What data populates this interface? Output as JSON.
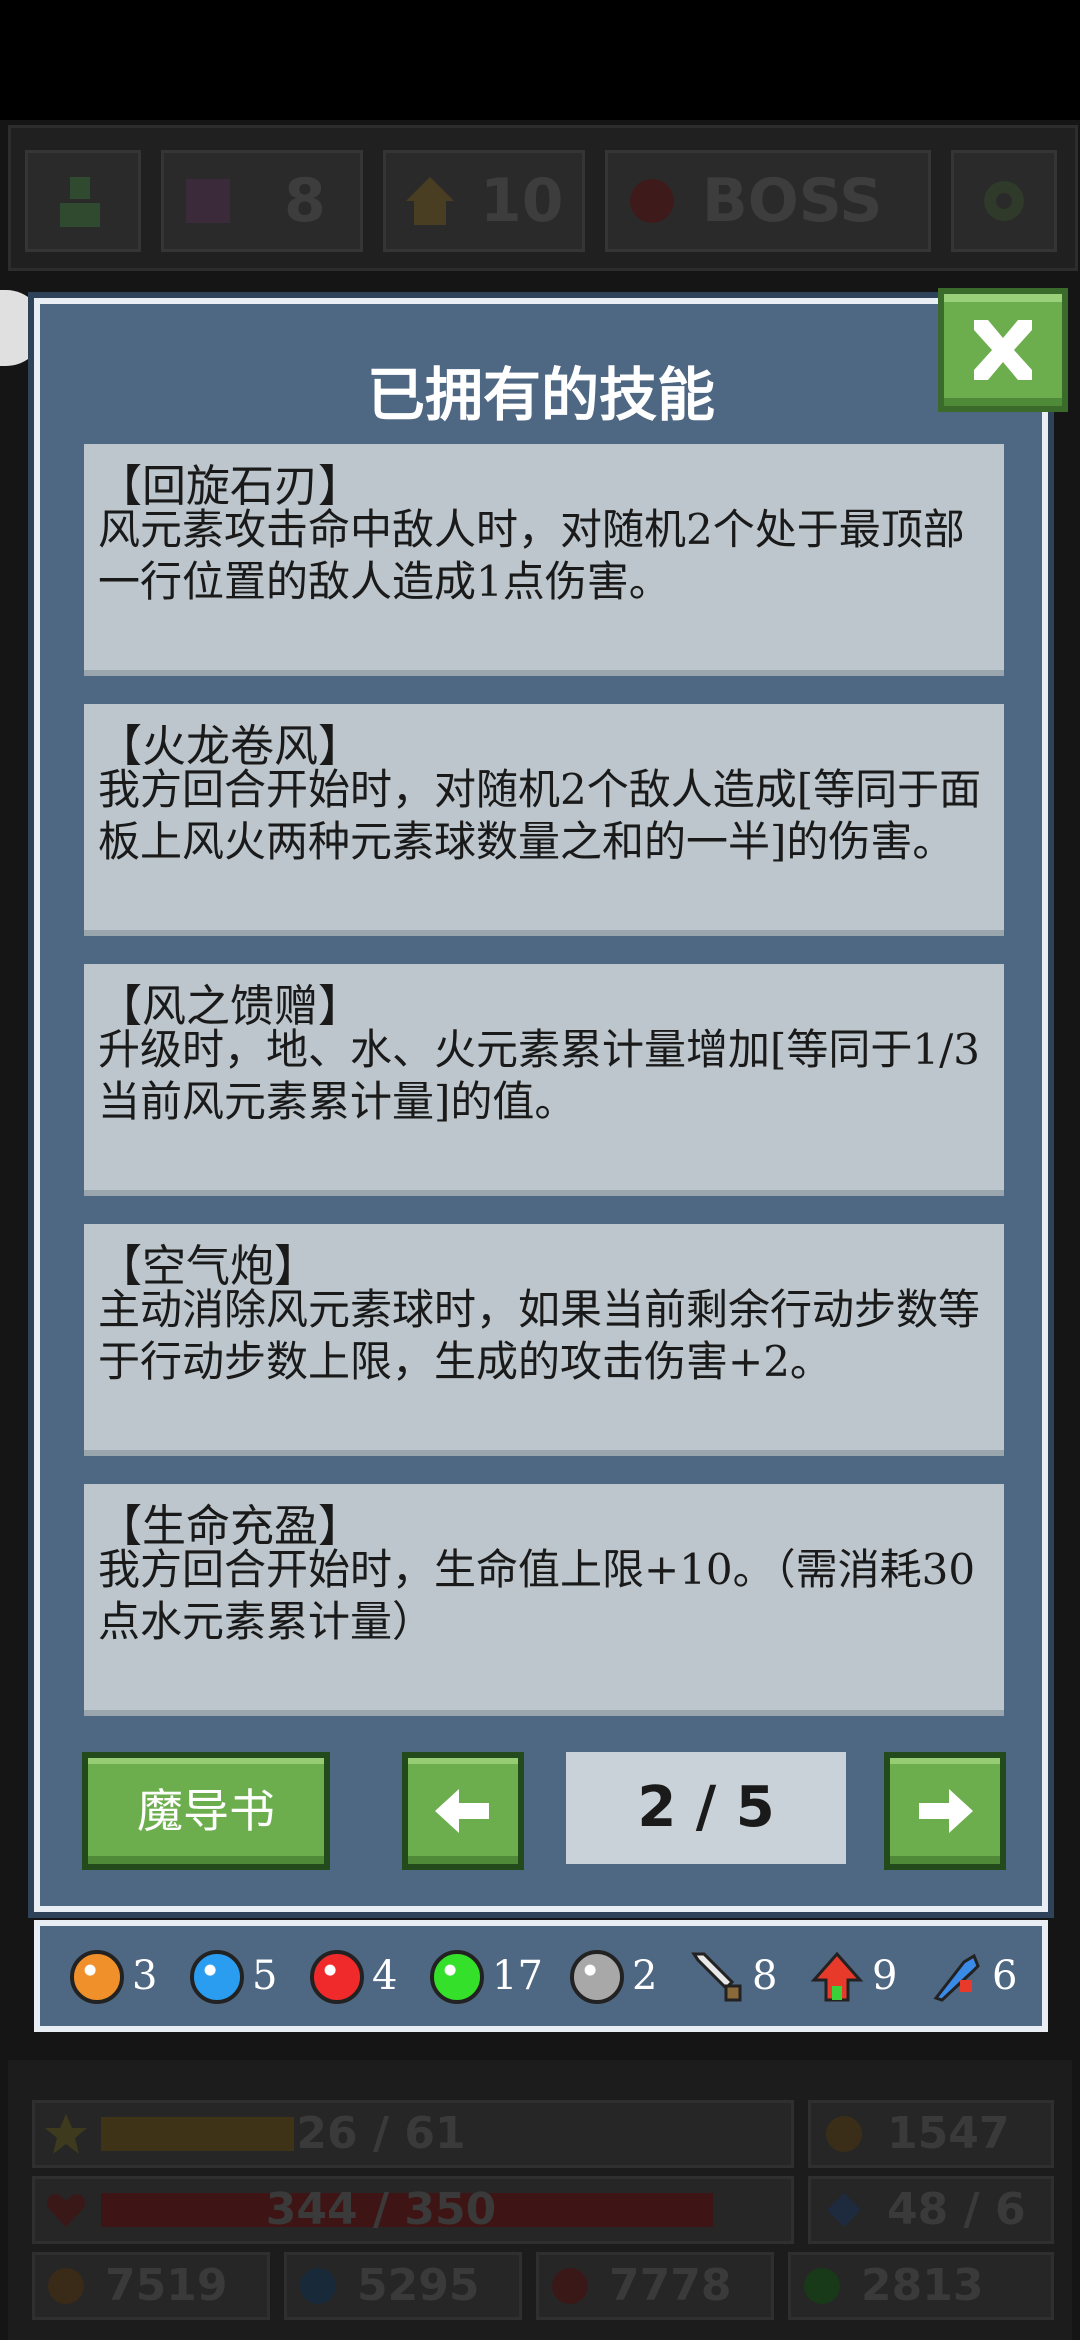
{
  "topbar": {
    "skull_count": "8",
    "level_count": "10",
    "boss_label": "BOSS"
  },
  "dialog": {
    "title": "已拥有的技能",
    "skills": [
      {
        "name": "【回旋石刃】",
        "desc": "风元素攻击命中敌人时，对随机2个处于最顶部一行位置的敌人造成1点伤害。"
      },
      {
        "name": "【火龙卷风】",
        "desc": "我方回合开始时，对随机2个敌人造成[等同于面板上风火两种元素球数量之和的一半]的伤害。"
      },
      {
        "name": "【风之馈赠】",
        "desc": "升级时，地、水、火元素累计量增加[等同于1/3当前风元素累计量]的值。"
      },
      {
        "name": "【空气炮】",
        "desc": "主动消除风元素球时，如果当前剩余行动步数等于行动步数上限，生成的攻击伤害+2。"
      },
      {
        "name": "【生命充盈】",
        "desc": "我方回合开始时，生命值上限+10。（需消耗30点水元素累计量）"
      }
    ],
    "grimoire_label": "魔导书",
    "page_indicator": "2 / 5"
  },
  "inventory": [
    {
      "icon": "earth-orb-icon",
      "color": "#f0902a",
      "count": "3"
    },
    {
      "icon": "water-orb-icon",
      "color": "#2a9df0",
      "count": "5"
    },
    {
      "icon": "fire-orb-icon",
      "color": "#f02a2a",
      "count": "4"
    },
    {
      "icon": "wind-orb-icon",
      "color": "#34e02a",
      "count": "17"
    },
    {
      "icon": "stone-orb-icon",
      "color": "#a8a8a8",
      "count": "2"
    },
    {
      "icon": "sword-icon",
      "color": "#e8e8e8",
      "count": "8"
    },
    {
      "icon": "level-up-icon",
      "color": "#e83a2a",
      "count": "9"
    },
    {
      "icon": "magic-icon",
      "color": "#3a8ae8",
      "count": "6"
    }
  ],
  "stats": {
    "xp": "26 / 61",
    "xp_fraction": 0.43,
    "gold": "1547",
    "hp": "344 / 350",
    "hp_fraction": 0.98,
    "steps": "48 / 6",
    "earth_total": "7519",
    "water_total": "5295",
    "fire_total": "7778",
    "wind_total": "2813"
  },
  "colors": {
    "dialog_bg": "#4e6782",
    "card_bg": "#bcc6cc",
    "button_green": "#6cae4d"
  }
}
